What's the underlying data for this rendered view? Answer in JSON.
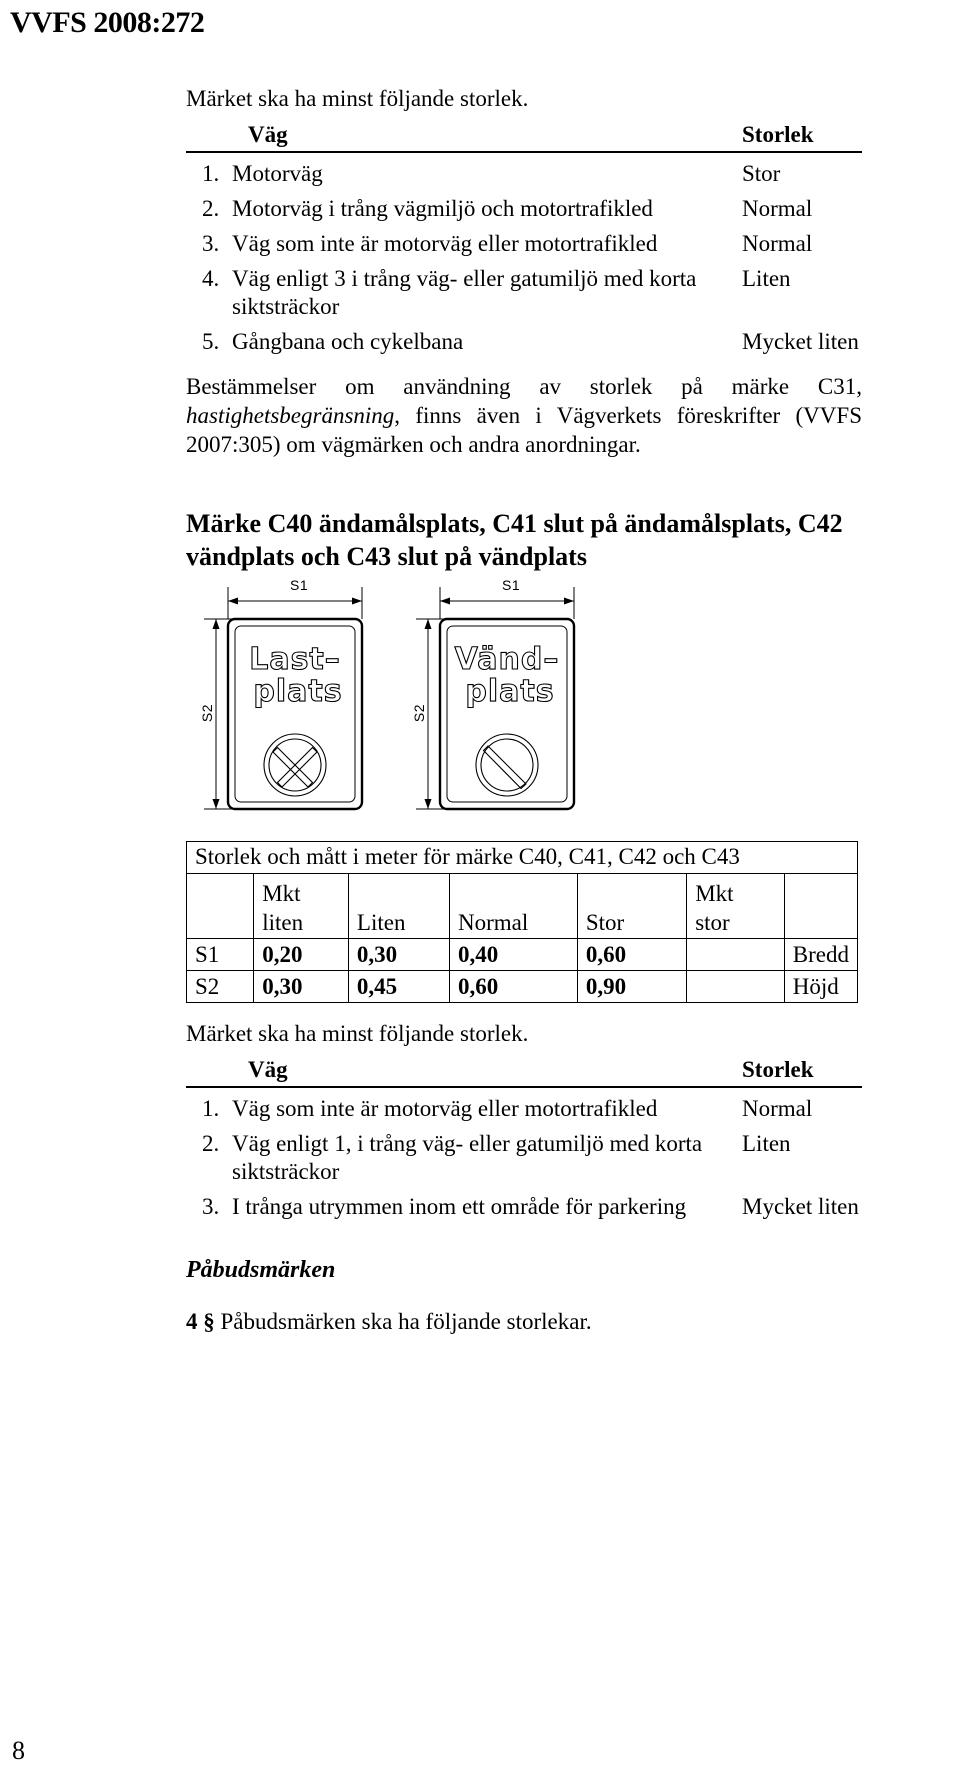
{
  "header": {
    "running_title": "VVFS 2008:272"
  },
  "page_number": "8",
  "section_top": {
    "lead": "Märket ska ha minst följande storlek.",
    "table": {
      "col_vag": "Väg",
      "col_storlek": "Storlek",
      "rows": [
        {
          "num": "1.",
          "desc": "Motorväg",
          "size": "Stor"
        },
        {
          "num": "2.",
          "desc": "Motorväg i trång vägmiljö och motortrafikled",
          "size": "Normal"
        },
        {
          "num": "3.",
          "desc": "Väg som inte är motorväg eller motortrafikled",
          "size": "Normal"
        },
        {
          "num": "4.",
          "desc": "Väg enligt 3 i trång väg- eller gatumiljö med korta siktsträckor",
          "size": "Liten"
        },
        {
          "num": "5.",
          "desc": "Gångbana och cykelbana",
          "size": "Mycket liten"
        }
      ]
    },
    "paragraph_part1": "Bestämmelser om användning av storlek på märke C31, ",
    "paragraph_italic": "hastighetsbegränsning",
    "paragraph_part2": ", finns även i Vägverkets föreskrifter (VVFS 2007:305) om vägmärken och andra anordningar."
  },
  "section_c40": {
    "heading": "Märke C40 ändamålsplats, C41 slut på ändamålsplats, C42 vändplats och C43 slut på vändplats",
    "signs": [
      {
        "name": "lastplats-sign",
        "line1": "Last–",
        "line2": "plats",
        "symbol": "circle-cross-icon",
        "dim_width_label": "S1",
        "dim_height_label": "S2"
      },
      {
        "name": "vandplats-sign",
        "line1": "Vänd–",
        "line2": "plats",
        "symbol": "circle-slash-icon",
        "dim_width_label": "S1",
        "dim_height_label": "S2"
      }
    ],
    "measure_table": {
      "title": "Storlek och mått i meter för märke C40, C41, C42 och C43",
      "headers": [
        "",
        "Mkt liten",
        "Liten",
        "Normal",
        "Stor",
        "Mkt stor",
        ""
      ],
      "header_mkt_liten_l1": "Mkt",
      "header_mkt_liten_l2": "liten",
      "header_liten": "Liten",
      "header_normal": "Normal",
      "header_stor": "Stor",
      "header_mkt_stor_l1": "Mkt",
      "header_mkt_stor_l2": "stor",
      "rows": [
        {
          "label": "S1",
          "mkt_liten": "0,20",
          "liten": "0,30",
          "normal": "0,40",
          "stor": "0,60",
          "mkt_stor": "",
          "meaning": "Bredd"
        },
        {
          "label": "S2",
          "mkt_liten": "0,30",
          "liten": "0,45",
          "normal": "0,60",
          "stor": "0,90",
          "mkt_stor": "",
          "meaning": "Höjd"
        }
      ]
    },
    "lead": "Märket ska ha minst följande storlek.",
    "table": {
      "col_vag": "Väg",
      "col_storlek": "Storlek",
      "rows": [
        {
          "num": "1.",
          "desc": "Väg som inte är motorväg eller motortrafikled",
          "size": "Normal"
        },
        {
          "num": "2.",
          "desc": "Väg enligt 1, i trång väg- eller gatumiljö med korta siktsträckor",
          "size": "Liten"
        },
        {
          "num": "3.",
          "desc": "I trånga utrymmen inom ett område för parkering",
          "size": "Mycket liten"
        }
      ]
    }
  },
  "section_pabud": {
    "heading": "Påbudsmärken",
    "section_number": "4 §",
    "text": " Påbudsmärken ska ha följande storlekar."
  },
  "colors": {
    "text": "#000000",
    "background": "#ffffff",
    "rule": "#000000"
  }
}
